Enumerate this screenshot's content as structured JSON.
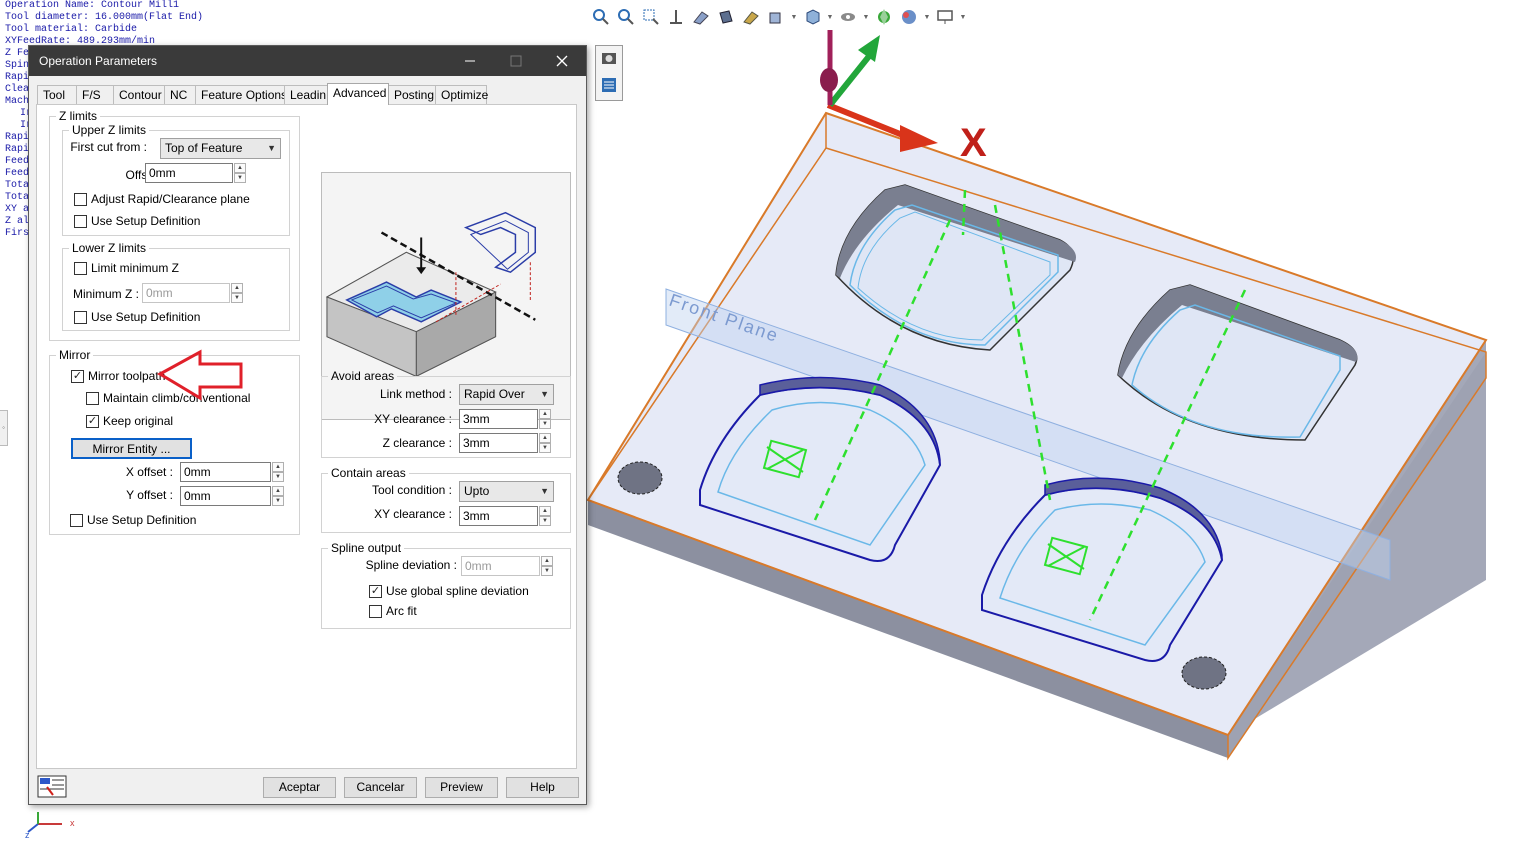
{
  "info_lines": [
    {
      "text": "Operation Name: Contour Mill1",
      "indent": false
    },
    {
      "text": "Tool diameter: 16.000mm(Flat End)",
      "indent": false
    },
    {
      "text": "Tool material: Carbide",
      "indent": false
    },
    {
      "text": "XYFeedRate: 489.293mm/min",
      "indent": false
    },
    {
      "text": "Z Feed",
      "indent": false
    },
    {
      "text": "Spind",
      "indent": false
    },
    {
      "text": "Rapid",
      "indent": false
    },
    {
      "text": "Clear",
      "indent": false
    },
    {
      "text": "Mach",
      "indent": false
    },
    {
      "text": "Ir",
      "indent": true
    },
    {
      "text": "Ir",
      "indent": true
    },
    {
      "text": "Rapid",
      "indent": false
    },
    {
      "text": "Rapid",
      "indent": false
    },
    {
      "text": "Feed",
      "indent": false
    },
    {
      "text": "Feed",
      "indent": false
    },
    {
      "text": "Total",
      "indent": false
    },
    {
      "text": "Total",
      "indent": false
    },
    {
      "text": "XY al",
      "indent": false
    },
    {
      "text": "Z allo",
      "indent": false
    },
    {
      "text": "First",
      "indent": false
    }
  ],
  "dialog": {
    "title": "Operation Parameters",
    "tabs": [
      "Tool",
      "F/S",
      "Contour",
      "NC",
      "Feature Options",
      "Leadin",
      "Advanced",
      "Posting",
      "Optimize"
    ],
    "active_tab": "Advanced",
    "z_limits": {
      "legend": "Z limits",
      "upper": {
        "legend": "Upper Z limits",
        "first_cut_label": "First cut from :",
        "first_cut_value": "Top of Feature",
        "offset_label": "Offset :",
        "offset_value": "0mm",
        "adjust_rapid": {
          "label": "Adjust Rapid/Clearance plane",
          "checked": false
        },
        "use_setup": {
          "label": "Use Setup Definition",
          "checked": false
        }
      },
      "lower": {
        "legend": "Lower Z limits",
        "limit_min": {
          "label": "Limit minimum Z",
          "checked": false
        },
        "min_z_label": "Minimum Z :",
        "min_z_value": "0mm",
        "use_setup": {
          "label": "Use Setup Definition",
          "checked": false
        }
      }
    },
    "mirror": {
      "legend": "Mirror",
      "mirror_toolpath": {
        "label": "Mirror toolpath",
        "checked": true
      },
      "maintain_climb": {
        "label": "Maintain climb/conventional",
        "checked": false
      },
      "keep_original": {
        "label": "Keep original",
        "checked": true
      },
      "mirror_entity_button": "Mirror Entity ...",
      "x_offset_label": "X offset :",
      "x_offset_value": "0mm",
      "y_offset_label": "Y offset :",
      "y_offset_value": "0mm",
      "use_setup": {
        "label": "Use Setup Definition",
        "checked": false
      }
    },
    "avoid_areas": {
      "legend": "Avoid areas",
      "link_method_label": "Link method :",
      "link_method_value": "Rapid Over",
      "xy_clearance_label": "XY clearance :",
      "xy_clearance_value": "3mm",
      "z_clearance_label": "Z clearance :",
      "z_clearance_value": "3mm"
    },
    "contain_areas": {
      "legend": "Contain areas",
      "tool_condition_label": "Tool condition :",
      "tool_condition_value": "Upto",
      "xy_clearance_label": "XY clearance :",
      "xy_clearance_value": "3mm"
    },
    "spline_output": {
      "legend": "Spline output",
      "deviation_label": "Spline deviation :",
      "deviation_value": "0mm",
      "use_global": {
        "label": "Use global spline deviation",
        "checked": true
      },
      "arc_fit": {
        "label": "Arc fit",
        "checked": false
      }
    },
    "buttons": {
      "ok": "Aceptar",
      "cancel": "Cancelar",
      "preview": "Preview",
      "help": "Help"
    }
  },
  "viewport": {
    "x_axis_label": "X",
    "plane_label": "Front Plane",
    "triad_x": "x",
    "triad_z": "z"
  },
  "colors": {
    "annotation_arrow": "#e0202a",
    "part_edge": "#d97a2a",
    "toolpath_green": "#2ee02e",
    "pocket_blue": "#1a1aa8"
  }
}
